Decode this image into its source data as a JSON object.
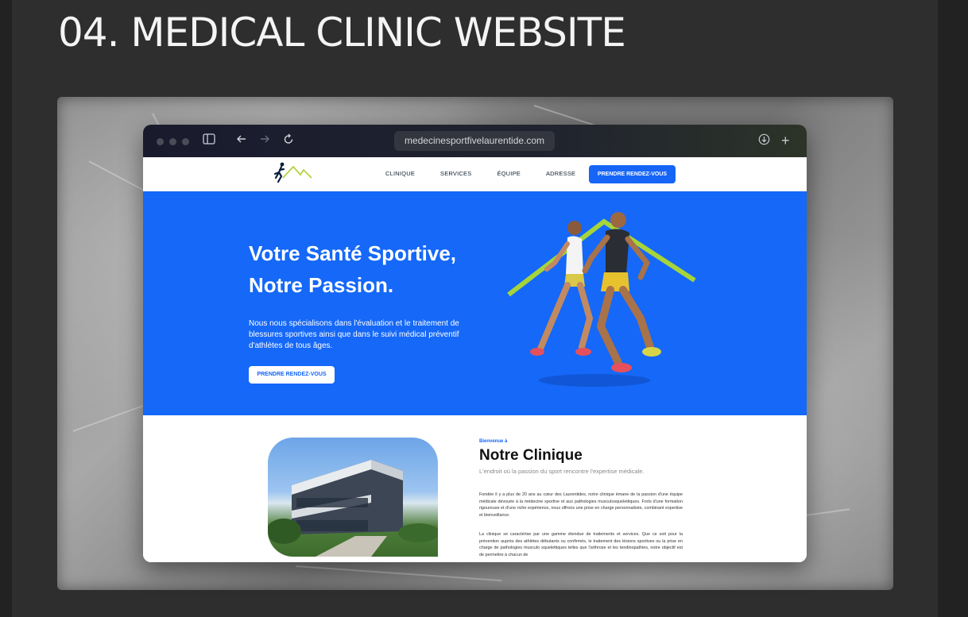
{
  "page_title": "04. MEDICAL CLINIC WEBSITE",
  "browser": {
    "url": "medecinesportfivelaurentide.com"
  },
  "site": {
    "nav": [
      "CLINIQUE",
      "SERVICES",
      "ÉQUIPE",
      "ADRESSE"
    ],
    "nav_cta": "PRENDRE RENDEZ-VOUS",
    "hero": {
      "title_line1": "Votre Santé Sportive,",
      "title_line2": "Notre Passion.",
      "text": "Nous nous spécialisons dans l'évaluation et le traitement de blessures sportives ainsi que dans le suivi médical préventif d'athlètes de tous âges.",
      "cta": "PRENDRE RENDEZ-VOUS"
    },
    "about": {
      "welcome": "Bienvenue à",
      "title": "Notre Clinique",
      "subtitle": "L'endroit où la passion du sport rencontre l'expertise médicale.",
      "p1": "Fondée il y a plus de 20 ans au cœur des Laurentides, notre clinique émane de la passion d'une équipe médicale dévouée à la médecine sportive et aux pathologies musculosquelettiques. Forts d'une formation rigoureuse et d'une riche expérience, nous offrons une prise en charge personnalisée, combinant expertise et bienveillance.",
      "p2": "La clinique se caractérise par une gamme étendue de traitements et services. Que ce soit pour la prévention auprès des athlètes débutants ou confirmés, le traitement des lésions sportives ou la prise en charge de pathologies musculo squelettiques telles que l'arthrose et les tendinopathies, notre objectif est de permettre à chacun de"
    }
  },
  "colors": {
    "brand_blue": "#1665f7",
    "accent_green": "#9fd33a"
  }
}
